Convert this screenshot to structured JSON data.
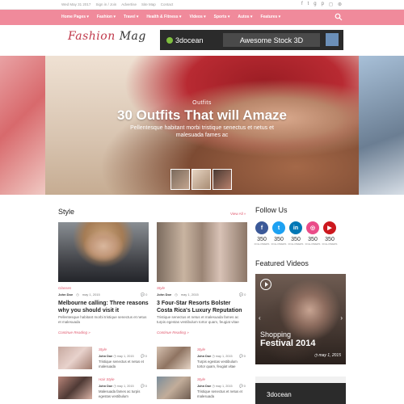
{
  "topbar": {
    "date": "Wed May 31 2017",
    "links": [
      "Sign in / Join",
      "Advertise",
      "Site Map",
      "Contact"
    ]
  },
  "nav": {
    "items": [
      "Home Pages ▾",
      "Fashion ▾",
      "Travel ▾",
      "Health & Fitness ▾",
      "Videos ▾",
      "Sports ▾",
      "Autos ▾",
      "Features ▾"
    ]
  },
  "logo": {
    "part1": "Fashion",
    "part2": "Mag"
  },
  "banner": {
    "brand": "3docean",
    "cta": "Awesome Stock 3D"
  },
  "slider": {
    "category": "Outfits",
    "title": "30 Outfits That will Amaze",
    "subtitle": "Pellentesque habitant morbi tristique senectus et netus et malesuada fames ac"
  },
  "style_section": {
    "title": "Style",
    "view_all": "View All »",
    "big_posts": [
      {
        "category": "Glasses",
        "author": "John Doe",
        "date": "may 1, 2015",
        "comments": "0",
        "title": "Melbourne calling: Three reasons why you should visit it",
        "excerpt": "Pellentesque habitant morbi tristique senectus et netus et malesuada",
        "readmore": "Continue Reading »"
      },
      {
        "category": "Style",
        "author": "John Doe",
        "date": "may 1, 2015",
        "comments": "0",
        "title": "3 Four-Star Resorts Bolster Costa Rica's Luxury Reputation",
        "excerpt": "Tristique senectus et netus et malesuada fames ac turpis egestas vestibulum tortor quam, feugiat vitae",
        "readmore": "Continue Reading »"
      }
    ],
    "small_posts": [
      {
        "category": "Style",
        "author": "John Doe",
        "date": "may 1, 2015",
        "comments": "0",
        "excerpt": "Tristique senectus et netus et malesuada"
      },
      {
        "category": "Style",
        "author": "John Doe",
        "date": "may 1, 2015",
        "comments": "0",
        "excerpt": "Turpis egestas vestibulum tortor quam, feugiat vitae"
      },
      {
        "category": "Hair Style",
        "author": "John Doe",
        "date": "may 1, 2015",
        "comments": "0",
        "excerpt": "Malesuada fames ac turpis egestas vestibulum"
      },
      {
        "category": "Style",
        "author": "John Doe",
        "date": "may 1, 2015",
        "comments": "0",
        "excerpt": "Tristique senectus et netus et malesuada"
      }
    ]
  },
  "follow": {
    "title": "Follow Us",
    "items": [
      {
        "icon": "f",
        "count": "350",
        "label": "FOLLOWERS",
        "color": "#3b5998"
      },
      {
        "icon": "t",
        "count": "350",
        "label": "FOLLOWERS",
        "color": "#1da1f2"
      },
      {
        "icon": "in",
        "count": "350",
        "label": "FOLLOWERS",
        "color": "#0077b5"
      },
      {
        "icon": "◎",
        "count": "350",
        "label": "FOLLOWERS",
        "color": "#ea4c89"
      },
      {
        "icon": "▶",
        "count": "350",
        "label": "FOLLOWERS",
        "color": "#cc181e"
      }
    ]
  },
  "videos": {
    "title": "Featured Videos",
    "video_line1": "Shopping",
    "video_line2": "Festival 2014",
    "date": "may 1, 2015"
  },
  "banner2": {
    "brand": "3docean"
  }
}
